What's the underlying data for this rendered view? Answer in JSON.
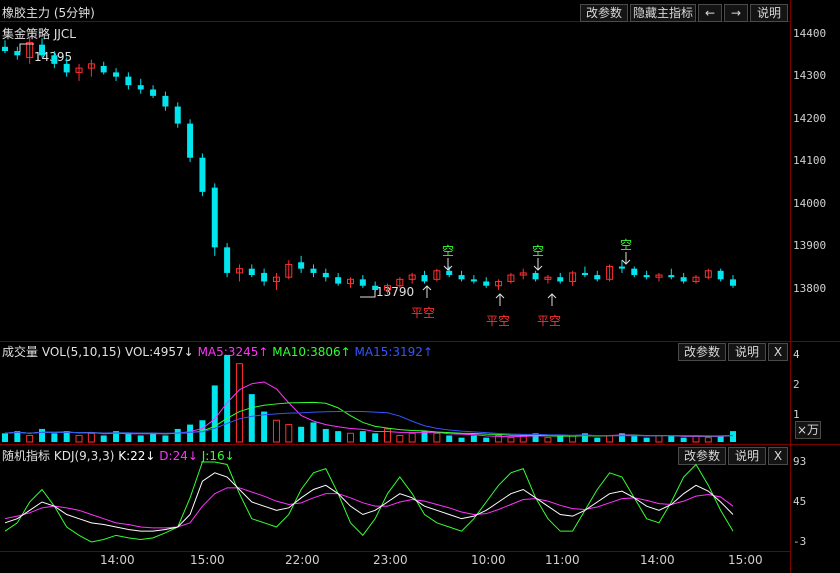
{
  "header": {
    "title": "橡胶主力 (5分钟)",
    "strategy": "集金策略 JJCL",
    "buttons": {
      "params": "改参数",
      "hide_indicator": "隐藏主指标",
      "prev": "←",
      "next": "→",
      "help": "说明"
    }
  },
  "price_panel": {
    "y_ticks": [
      "14400",
      "14300",
      "14200",
      "14100",
      "14000",
      "13900",
      "13800"
    ],
    "high_label": "14395",
    "low_label": "13790",
    "signals": [
      {
        "label": "平空",
        "type": "buy"
      },
      {
        "label": "空",
        "type": "sell"
      },
      {
        "label": "平空",
        "type": "buy"
      },
      {
        "label": "空",
        "type": "sell"
      },
      {
        "label": "平空",
        "type": "buy"
      },
      {
        "label": "空",
        "type": "sell"
      }
    ]
  },
  "volume_panel": {
    "title": "成交量",
    "name": "VOL(5,10,15)",
    "vol": "VOL:4957↓",
    "ma5": "MA5:3245↑",
    "ma10": "MA10:3806↑",
    "ma15": "MA15:3192↑",
    "y_ticks": [
      "4",
      "2",
      "1"
    ],
    "unit_button": "×万",
    "buttons": {
      "params": "改参数",
      "help": "说明",
      "close": "X"
    }
  },
  "kdj_panel": {
    "title": "随机指标",
    "name": "KDJ(9,3,3)",
    "k": "K:22↓",
    "d": "D:24↓",
    "j": "J:16↓",
    "y_ticks": [
      "93",
      "45",
      "-3"
    ],
    "buttons": {
      "params": "改参数",
      "help": "说明",
      "close": "X"
    }
  },
  "x_axis": [
    "14:00",
    "15:00",
    "22:00",
    "23:00",
    "10:00",
    "11:00",
    "14:00",
    "15:00"
  ],
  "colors": {
    "up": "#ff3030",
    "down": "#00e5ee",
    "k": "#ffffff",
    "d": "#ff33ff",
    "j": "#33ff33",
    "ma5": "#ff33ff",
    "ma10": "#33ff33",
    "ma15": "#3355ff",
    "grid": "#7a0000"
  },
  "chart_data": {
    "type": "candlestick",
    "price_range": [
      13750,
      14440
    ],
    "candles": [
      [
        14370,
        14385,
        14355,
        14360
      ],
      [
        14360,
        14370,
        14340,
        14350
      ],
      [
        14345,
        14395,
        14330,
        14380
      ],
      [
        14375,
        14390,
        14345,
        14350
      ],
      [
        14350,
        14360,
        14320,
        14330
      ],
      [
        14330,
        14345,
        14300,
        14310
      ],
      [
        14310,
        14330,
        14290,
        14320
      ],
      [
        14320,
        14340,
        14300,
        14330
      ],
      [
        14325,
        14335,
        14305,
        14310
      ],
      [
        14310,
        14320,
        14290,
        14300
      ],
      [
        14300,
        14310,
        14270,
        14280
      ],
      [
        14280,
        14295,
        14260,
        14270
      ],
      [
        14270,
        14280,
        14250,
        14255
      ],
      [
        14255,
        14265,
        14220,
        14230
      ],
      [
        14230,
        14240,
        14180,
        14190
      ],
      [
        14190,
        14200,
        14100,
        14110
      ],
      [
        14110,
        14120,
        14020,
        14030
      ],
      [
        14040,
        14050,
        13880,
        13900
      ],
      [
        13900,
        13910,
        13830,
        13840
      ],
      [
        13840,
        13860,
        13820,
        13850
      ],
      [
        13850,
        13860,
        13830,
        13835
      ],
      [
        13840,
        13850,
        13810,
        13820
      ],
      [
        13820,
        13840,
        13800,
        13830
      ],
      [
        13830,
        13870,
        13825,
        13860
      ],
      [
        13865,
        13880,
        13840,
        13850
      ],
      [
        13850,
        13860,
        13830,
        13840
      ],
      [
        13840,
        13850,
        13820,
        13830
      ],
      [
        13830,
        13840,
        13810,
        13815
      ],
      [
        13815,
        13830,
        13805,
        13825
      ],
      [
        13825,
        13835,
        13805,
        13810
      ],
      [
        13810,
        13820,
        13795,
        13800
      ],
      [
        13800,
        13815,
        13790,
        13810
      ],
      [
        13810,
        13830,
        13805,
        13825
      ],
      [
        13825,
        13840,
        13815,
        13835
      ],
      [
        13835,
        13845,
        13815,
        13820
      ],
      [
        13825,
        13850,
        13820,
        13845
      ],
      [
        13845,
        13855,
        13830,
        13835
      ],
      [
        13835,
        13845,
        13820,
        13825
      ],
      [
        13825,
        13835,
        13815,
        13820
      ],
      [
        13820,
        13830,
        13805,
        13810
      ],
      [
        13810,
        13825,
        13800,
        13820
      ],
      [
        13820,
        13840,
        13815,
        13835
      ],
      [
        13835,
        13850,
        13825,
        13840
      ],
      [
        13840,
        13845,
        13820,
        13825
      ],
      [
        13825,
        13835,
        13815,
        13830
      ],
      [
        13830,
        13840,
        13815,
        13820
      ],
      [
        13820,
        13845,
        13810,
        13840
      ],
      [
        13840,
        13855,
        13830,
        13835
      ],
      [
        13835,
        13845,
        13820,
        13825
      ],
      [
        13825,
        13860,
        13820,
        13855
      ],
      [
        13855,
        13870,
        13840,
        13850
      ],
      [
        13850,
        13855,
        13830,
        13835
      ],
      [
        13835,
        13845,
        13825,
        13830
      ],
      [
        13830,
        13840,
        13820,
        13835
      ],
      [
        13835,
        13850,
        13825,
        13830
      ],
      [
        13830,
        13840,
        13815,
        13820
      ],
      [
        13820,
        13835,
        13815,
        13830
      ],
      [
        13830,
        13850,
        13825,
        13845
      ],
      [
        13845,
        13850,
        13820,
        13825
      ],
      [
        13825,
        13835,
        13805,
        13810
      ]
    ],
    "volume": [
      0.4,
      0.5,
      0.3,
      0.6,
      0.4,
      0.5,
      0.3,
      0.4,
      0.3,
      0.5,
      0.4,
      0.3,
      0.4,
      0.3,
      0.6,
      0.8,
      1.0,
      2.6,
      4.0,
      3.6,
      2.2,
      1.4,
      1.0,
      0.8,
      0.7,
      0.9,
      0.6,
      0.5,
      0.4,
      0.5,
      0.4,
      0.6,
      0.3,
      0.4,
      0.5,
      0.4,
      0.3,
      0.2,
      0.3,
      0.2,
      0.3,
      0.2,
      0.3,
      0.4,
      0.2,
      0.3,
      0.3,
      0.4,
      0.2,
      0.3,
      0.4,
      0.3,
      0.2,
      0.3,
      0.3,
      0.2,
      0.3,
      0.2,
      0.3,
      0.5
    ],
    "kdj": {
      "k": [
        20,
        25,
        35,
        45,
        40,
        30,
        25,
        20,
        18,
        15,
        12,
        10,
        10,
        12,
        15,
        30,
        70,
        80,
        75,
        60,
        45,
        40,
        35,
        38,
        50,
        60,
        65,
        55,
        40,
        30,
        35,
        45,
        55,
        50,
        40,
        35,
        30,
        25,
        28,
        35,
        45,
        55,
        60,
        50,
        40,
        30,
        28,
        35,
        45,
        55,
        58,
        50,
        40,
        35,
        42,
        55,
        65,
        58,
        45,
        30
      ],
      "d": [
        25,
        28,
        32,
        38,
        40,
        38,
        35,
        30,
        25,
        20,
        18,
        15,
        14,
        14,
        15,
        20,
        40,
        55,
        62,
        62,
        57,
        52,
        46,
        42,
        44,
        50,
        55,
        55,
        50,
        44,
        40,
        40,
        45,
        48,
        46,
        42,
        38,
        33,
        30,
        31,
        36,
        42,
        48,
        49,
        46,
        41,
        37,
        36,
        39,
        44,
        49,
        50,
        47,
        43,
        42,
        46,
        52,
        54,
        51,
        40
      ],
      "j": [
        10,
        20,
        45,
        60,
        40,
        15,
        5,
        -3,
        0,
        5,
        2,
        0,
        2,
        8,
        15,
        50,
        93,
        93,
        90,
        55,
        25,
        20,
        15,
        30,
        60,
        80,
        85,
        55,
        20,
        5,
        25,
        55,
        75,
        55,
        30,
        20,
        15,
        10,
        25,
        45,
        65,
        80,
        85,
        50,
        25,
        10,
        10,
        35,
        60,
        80,
        75,
        50,
        25,
        20,
        45,
        75,
        90,
        65,
        35,
        10
      ]
    }
  }
}
